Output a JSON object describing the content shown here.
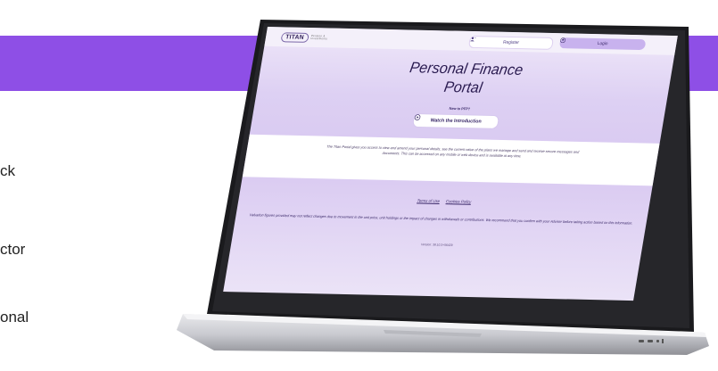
{
  "background": {
    "band_color": "#8e4fe6",
    "fragments": [
      "ck",
      "ctor",
      "onal"
    ]
  },
  "portal": {
    "logo": {
      "name": "TITAN",
      "sub": "Pension & Investments"
    },
    "register_label": "Register",
    "login_label": "Login",
    "title_line1": "Personal Finance",
    "title_line2": "Portal",
    "new_to": "New to PFP?",
    "watch_label": "Watch the Introduction",
    "description": "The Titan Portal gives you access to view and amend your personal details, see the current value of the plans we manage and send and receive secure messages and documents. This can be accessed on any mobile or web device and is available at any time.",
    "footer": {
      "terms": "Terms of Use",
      "cookies": "Cookies Policy"
    },
    "disclaimer": "Valuation figures provided may not reflect changes due to movement in the unit price, unit holdings or the impact of changes in withdrawals or contributions. We recommend that you confirm with your Adviser before taking action based on this information.",
    "version": "Version: 38.10.3+56429"
  },
  "colors": {
    "accent": "#8e4fe6",
    "login_button": "#c8b2ee",
    "screen_bg": "#ddd0f3"
  }
}
